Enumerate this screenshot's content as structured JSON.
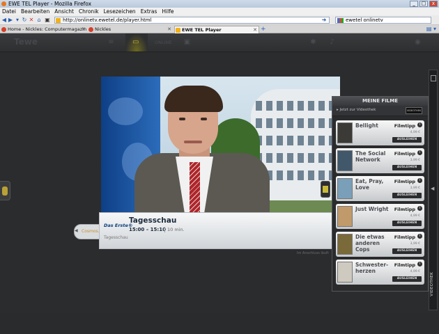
{
  "window": {
    "title": "EWE TEL Player - Mozilla Firefox",
    "min": "_",
    "max": "□",
    "close": "x"
  },
  "menu": [
    "Datei",
    "Bearbeiten",
    "Ansicht",
    "Chronik",
    "Lesezeichen",
    "Extras",
    "Hilfe"
  ],
  "nav": {
    "url": "http://onlinetv.ewetel.de/player.html",
    "search": "ewetel onlinetv"
  },
  "tabs": [
    {
      "label": "Home - Nickles: Computermagazin z..."
    },
    {
      "label": "Nickles"
    },
    {
      "label": "EWE TEL Player"
    }
  ],
  "app": {
    "brand": "Tewe",
    "toolbar_text": "ONLINE"
  },
  "epg": {
    "channel_logo": "Das Erste®",
    "title": "Tagesschau",
    "time": "15:00 – 15:10",
    "duration": "10 min.",
    "subtitle": "Tagesschau",
    "prev_channel": "Cosmos.tv",
    "next_hint": "Im Anschluss läuft"
  },
  "panel": {
    "title": "MEINE FILME",
    "videothek_link": "Jetzt zur Videothek",
    "videothek_logo": "VIDEOTHEK",
    "items": [
      {
        "title": "Bellight",
        "tag": "Filmtipp",
        "price": "4,99 €",
        "button": "AUSLEIHEN",
        "poster_color": "#3c3a36"
      },
      {
        "title": "The Social Network",
        "tag": "Filmtipp",
        "price": "3,99 €",
        "button": "AUSLEIHEN",
        "poster_color": "#41586b"
      },
      {
        "title": "Eat, Pray, Love",
        "tag": "Filmtipp",
        "price": "3,99 €",
        "button": "AUSLEIHEN",
        "poster_color": "#7a9fb8"
      },
      {
        "title": "Just Wright",
        "tag": "Filmtipp",
        "price": "4,99 €",
        "button": "AUSLEIHEN",
        "poster_color": "#c09a6a"
      },
      {
        "title": "Die etwas anderen Cops",
        "tag": "Filmtipp",
        "price": "3,99 €",
        "button": "AUSLEIHEN",
        "poster_color": "#7a6a3a"
      },
      {
        "title": "Schwester-herzen",
        "tag": "Filmtipp",
        "price": "4,99 €",
        "button": "AUSLEIHEN",
        "poster_color": "#cfcac0"
      }
    ]
  },
  "sidebar": {
    "label": "VIDEOTHEK"
  },
  "colors": {
    "accent": "#c9b93a",
    "tie": "#b1232a",
    "firefox": "#e87722"
  }
}
